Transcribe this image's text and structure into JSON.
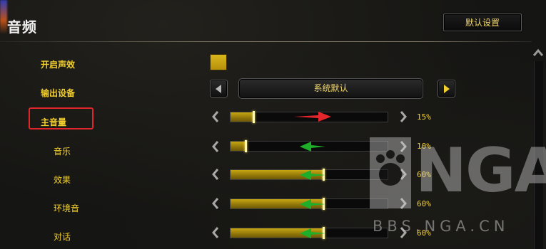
{
  "header": {
    "title": "音频"
  },
  "toolbar": {
    "default_label": "默认设置"
  },
  "settings": {
    "enable_sound": {
      "label": "开启声效",
      "checked": true
    },
    "output_device": {
      "label": "输出设备",
      "value": "系统默认"
    },
    "master": {
      "label": "主音量",
      "value_text": "15%",
      "value": 15
    },
    "music": {
      "label": "音乐",
      "value_text": "10%",
      "value": 10
    },
    "effects": {
      "label": "效果",
      "value_text": "60%",
      "value": 60
    },
    "ambient": {
      "label": "环境音",
      "value_text": "60%",
      "value": 60
    },
    "dialog": {
      "label": "对话",
      "value_text": "60%",
      "value": 60
    }
  },
  "watermark": {
    "brand": "NGA",
    "url": "BBS.NGA.CN"
  },
  "colors": {
    "accent_gold": "#f2cf2e",
    "highlight_red": "#e0262b",
    "annotation_red": "#e3262b",
    "annotation_green": "#1fae2a"
  }
}
